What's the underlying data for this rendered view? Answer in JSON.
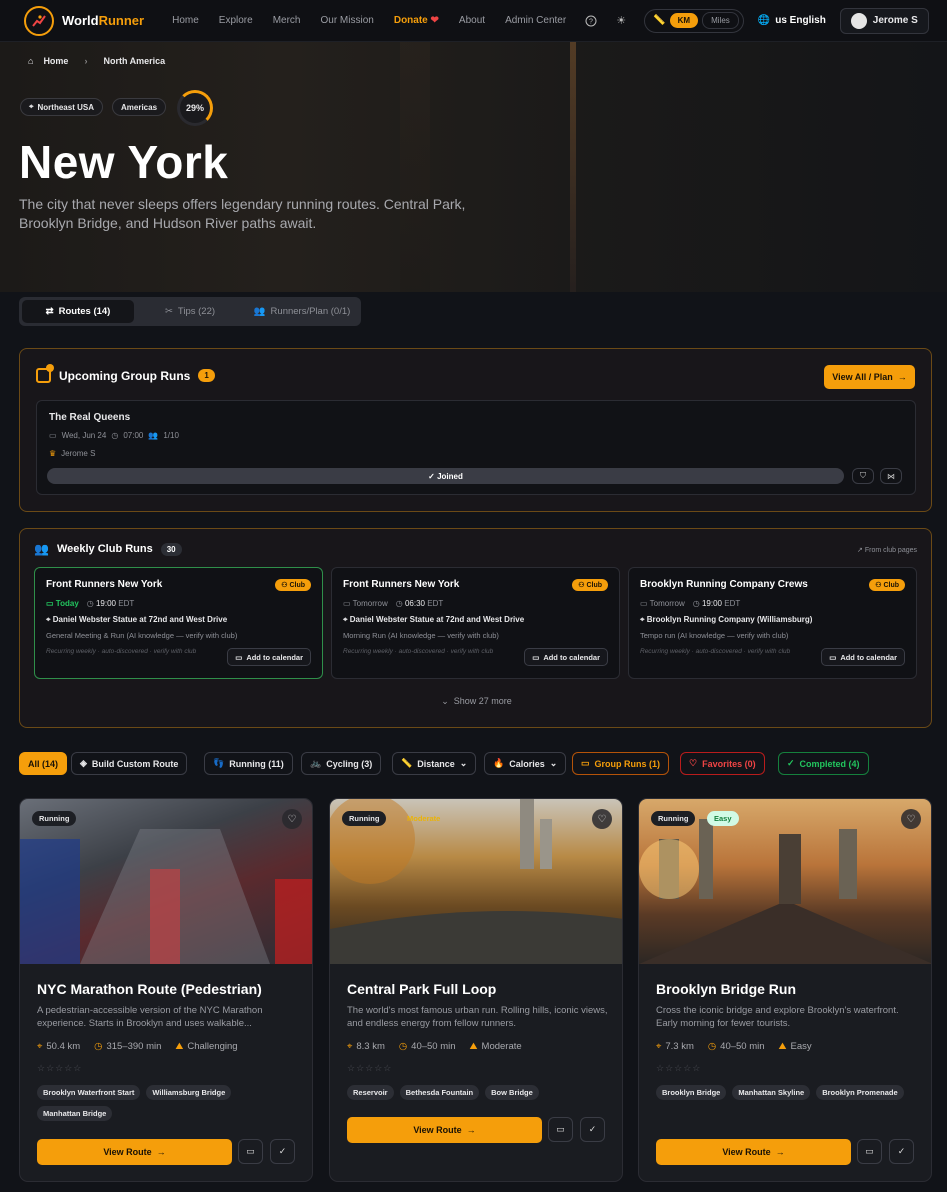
{
  "nav": {
    "brand_a": "World",
    "brand_b": "Runner",
    "links": [
      "Home",
      "Explore",
      "Merch",
      "Our Mission",
      "Donate",
      "About",
      "Admin Center"
    ],
    "unit_km": "KM",
    "unit_miles": "Miles",
    "lang": "us English",
    "user": "Jerome S"
  },
  "breadcrumb": {
    "home": "Home",
    "current": "North America"
  },
  "hero": {
    "tag_region": "Northeast USA",
    "tag_continent": "Americas",
    "progress": "29%",
    "progress_value": 0.29,
    "title": "New York",
    "subtitle": "The city that never sleeps offers legendary running routes. Central Park, Brooklyn Bridge, and Hudson River paths await."
  },
  "tabs": [
    "Routes (14)",
    "Tips (22)",
    "Runners/Plan (0/1)"
  ],
  "group_runs": {
    "title": "Upcoming Group Runs",
    "count": "1",
    "view_all": "View All / Plan",
    "run": {
      "name": "The Real Queens",
      "date": "Wed, Jun 24",
      "time": "07:00",
      "spots": "1/10",
      "host": "Jerome S",
      "status": "✓ Joined"
    }
  },
  "weekly": {
    "title": "Weekly Club Runs",
    "count": "30",
    "source": "From club pages",
    "show_more": "Show 27 more",
    "cards": [
      {
        "name": "Front Runners New York",
        "badge": "Club",
        "day": "Today",
        "time": "19:00",
        "tz": "EDT",
        "loc": "Daniel Webster Statue at 72nd and West Drive",
        "desc": "General Meeting & Run (AI knowledge — verify with club)",
        "note": "Recurring weekly · auto-discovered · verify with club",
        "cal": "Add to calendar"
      },
      {
        "name": "Front Runners New York",
        "badge": "Club",
        "day": "Tomorrow",
        "time": "06:30",
        "tz": "EDT",
        "loc": "Daniel Webster Statue at 72nd and West Drive",
        "desc": "Morning Run (AI knowledge — verify with club)",
        "note": "Recurring weekly · auto-discovered · verify with club",
        "cal": "Add to calendar"
      },
      {
        "name": "Brooklyn Running Company Crews",
        "badge": "Club",
        "day": "Tomorrow",
        "time": "19:00",
        "tz": "EDT",
        "loc": "Brooklyn Running Company (Williamsburg)",
        "desc": "Tempo run (AI knowledge — verify with club)",
        "note": "Recurring weekly · auto-discovered · verify with club",
        "cal": "Add to calendar"
      }
    ]
  },
  "filters": [
    "All (14)",
    "Build Custom Route",
    "Running (11)",
    "Cycling (3)",
    "Distance",
    "Calories",
    "Group Runs (1)",
    "Favorites (0)",
    "Completed (4)"
  ],
  "routes": [
    {
      "type": "Running",
      "difficulty_badge": "",
      "title": "NYC Marathon Route (Pedestrian)",
      "desc": "A pedestrian-accessible version of the NYC Marathon experience. Starts in Brooklyn and uses walkable...",
      "distance": "50.4 km",
      "duration": "315–390 min",
      "difficulty": "Challenging",
      "tags": [
        "Brooklyn Waterfront Start",
        "Williamsburg Bridge",
        "Manhattan Bridge"
      ],
      "cta": "View Route"
    },
    {
      "type": "Running",
      "difficulty_badge": "Moderate",
      "title": "Central Park Full Loop",
      "desc": "The world's most famous urban run. Rolling hills, iconic views, and endless energy from fellow runners.",
      "distance": "8.3 km",
      "duration": "40–50 min",
      "difficulty": "Moderate",
      "tags": [
        "Reservoir",
        "Bethesda Fountain",
        "Bow Bridge"
      ],
      "cta": "View Route"
    },
    {
      "type": "Running",
      "difficulty_badge": "Easy",
      "title": "Brooklyn Bridge Run",
      "desc": "Cross the iconic bridge and explore Brooklyn's waterfront. Early morning for fewer tourists.",
      "distance": "7.3 km",
      "duration": "40–50 min",
      "difficulty": "Easy",
      "tags": [
        "Brooklyn Bridge",
        "Manhattan Skyline",
        "Brooklyn Promenade"
      ],
      "cta": "View Route"
    }
  ],
  "colors": {
    "accent": "#f59e0b",
    "success": "#22c55e",
    "danger": "#ef4444"
  }
}
